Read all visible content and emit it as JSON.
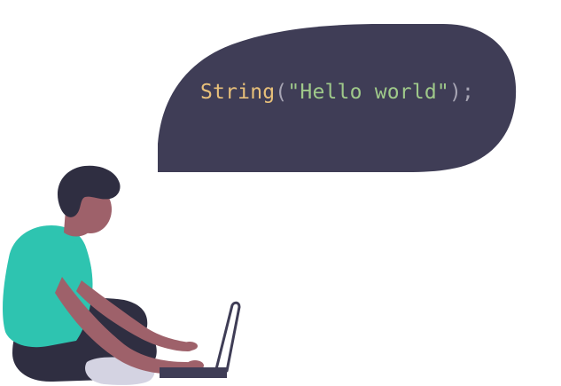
{
  "code": {
    "function_name": "String",
    "open_paren": "(",
    "string_literal": "\"Hello world\"",
    "close_paren": ")",
    "terminator": ";"
  },
  "colors": {
    "bubble": "#3f3d56",
    "function_name": "#e8c07a",
    "punctuation": "#a6a4b3",
    "string_literal": "#9fc98a",
    "shirt": "#2ec4b0",
    "skin": "#9e616a",
    "hair": "#2f2e41",
    "pants": "#2f2e41",
    "shoe": "#d4d3e2"
  },
  "illustration": {
    "speech_bubble": "speech-bubble",
    "person": "person-with-laptop",
    "device": "laptop-icon"
  }
}
